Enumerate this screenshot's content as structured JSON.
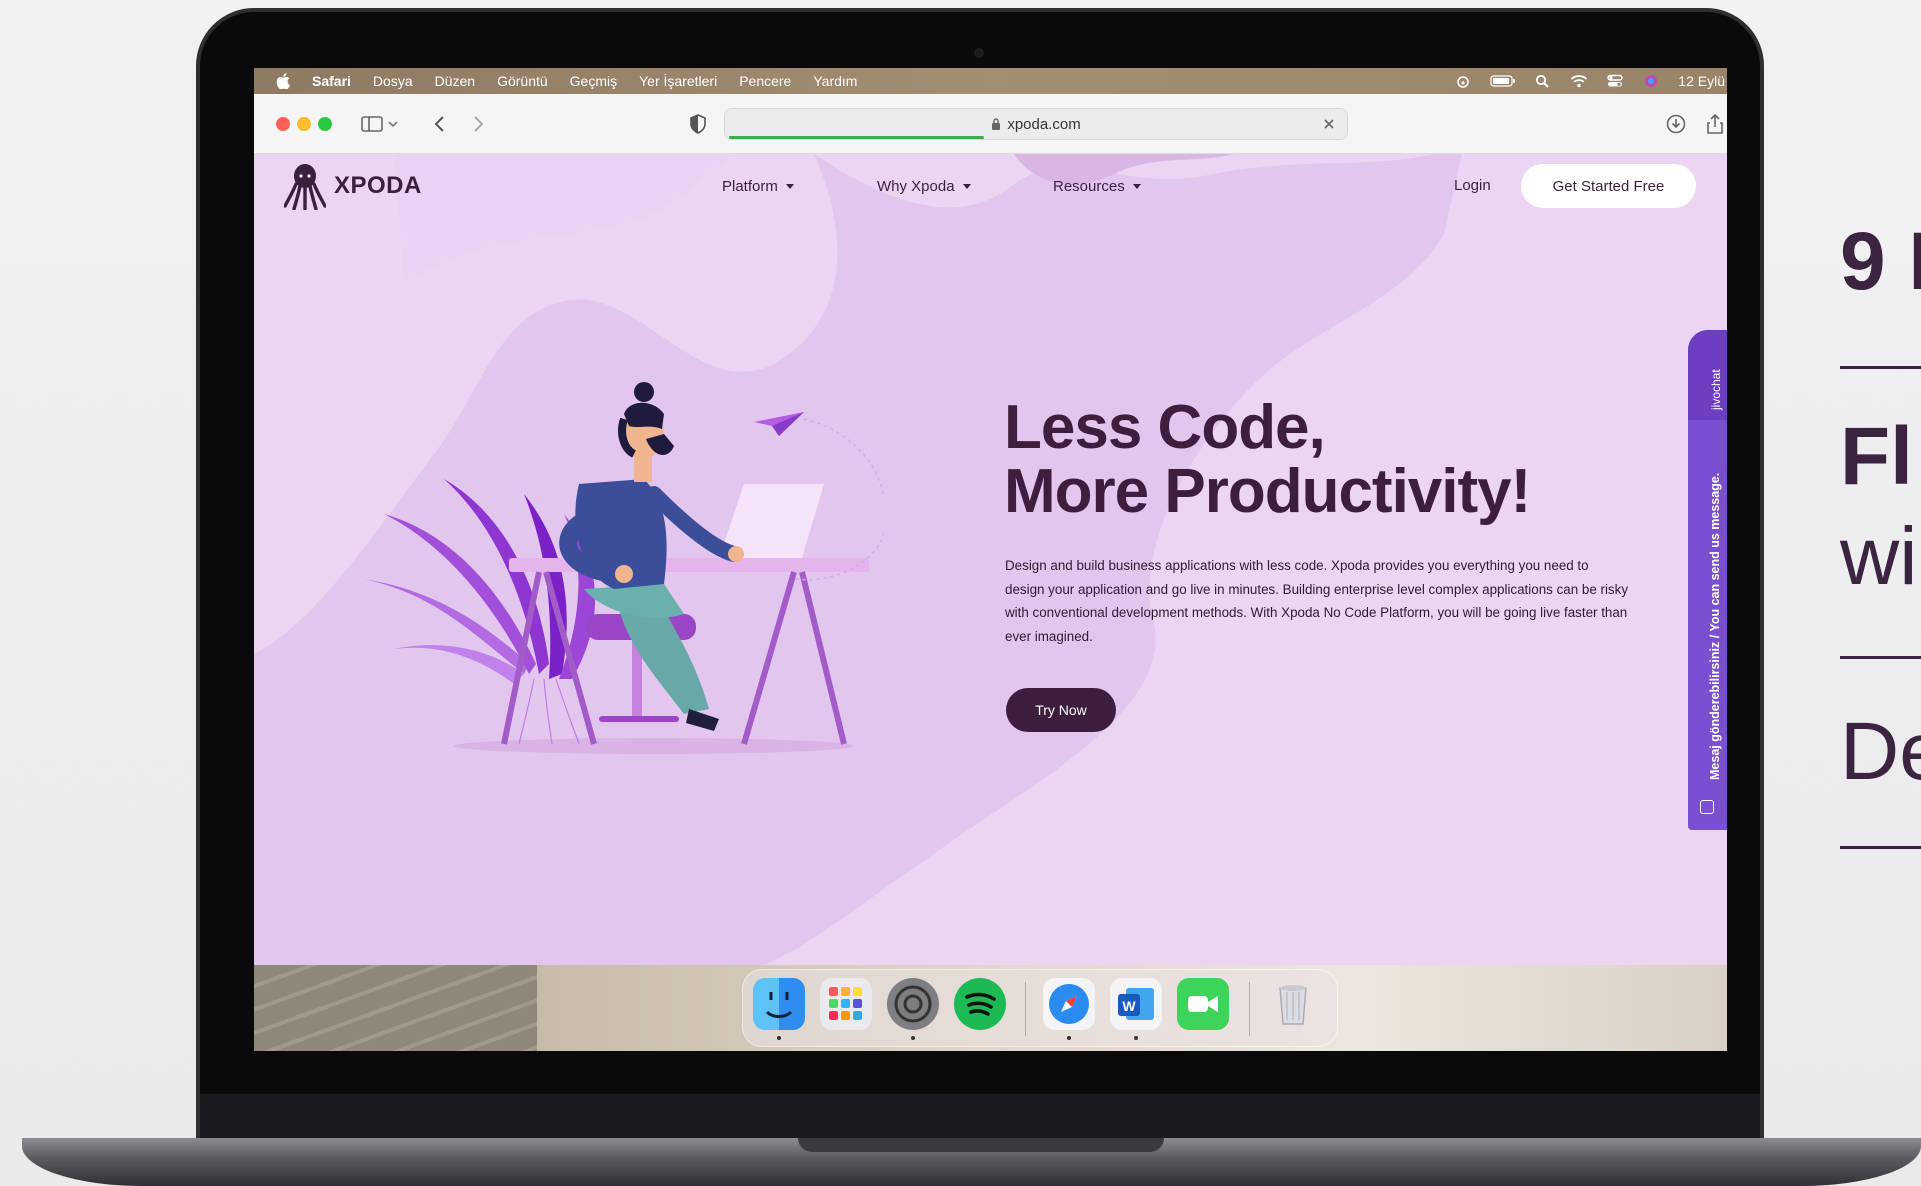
{
  "menubar": {
    "items": [
      "Safari",
      "Dosya",
      "Düzen",
      "Görüntü",
      "Geçmiş",
      "Yer İşaretleri",
      "Pencere",
      "Yardım"
    ],
    "clock": "12 Eylü"
  },
  "browser": {
    "url": "xpoda.com",
    "load_progress": 0.41
  },
  "site": {
    "logo_text": "XPODA",
    "nav": {
      "platform": "Platform",
      "why": "Why Xpoda",
      "resources": "Resources"
    },
    "login": "Login",
    "get_started": "Get Started Free",
    "hero": {
      "title_line1": "Less Code,",
      "title_line2": "More Productivity!",
      "description": "Design and build business applications with less code. Xpoda provides you everything you need to design your application and go live in minutes. Building enterprise level complex applications can be risky with conventional development methods. With Xpoda No Code Platform, you will be going live faster than ever imagined.",
      "cta": "Try Now"
    },
    "chat": {
      "brand": "jivochat",
      "message": "Mesaj gönderebilirsiniz / You can send us message."
    }
  },
  "side_slide": {
    "number": "9 I",
    "fl": "Fl",
    "wi": "wi",
    "de": "De"
  },
  "dock": {
    "apps": [
      "finder-icon",
      "launchpad-icon",
      "system-preferences-icon",
      "spotify-icon",
      "safari-icon",
      "word-icon",
      "facetime-icon",
      "trash-icon"
    ]
  },
  "colors": {
    "brand_dark": "#3d1e3f",
    "site_bg": "#ebd5f2",
    "chat_purple": "#7a4fd0"
  }
}
